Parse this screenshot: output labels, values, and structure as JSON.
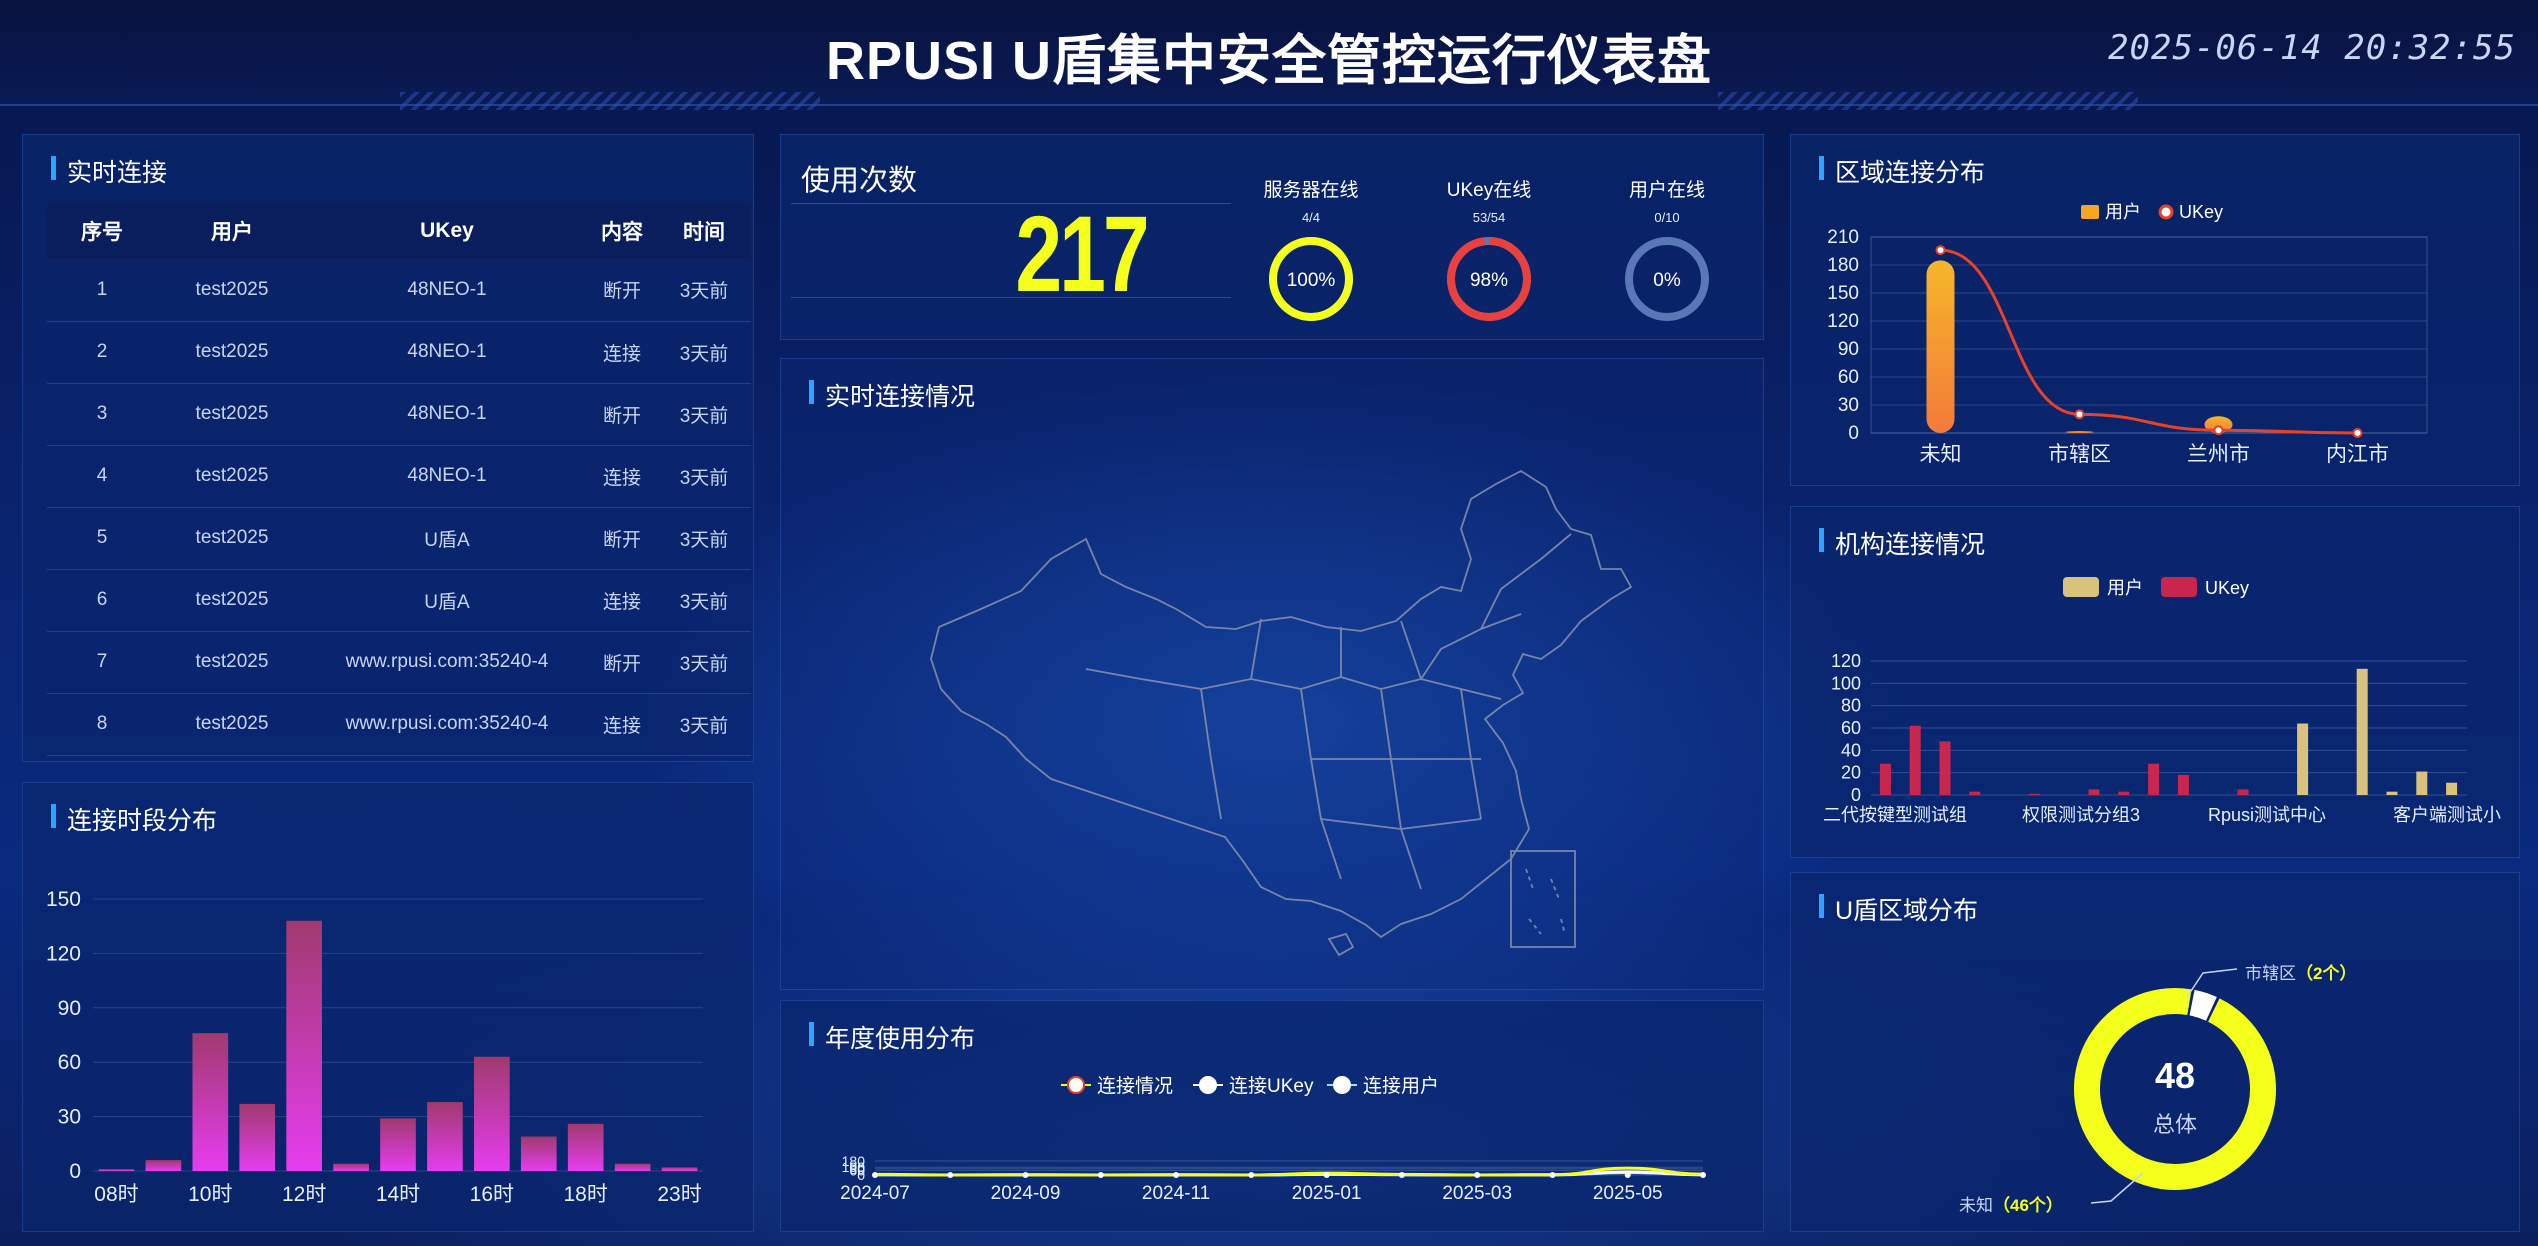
{
  "header": {
    "title": "RPUSI U盾集中安全管控运行仪表盘",
    "datetime": "2025-06-14 20:32:55"
  },
  "realtime_connections": {
    "title": "实时连接",
    "columns": [
      "序号",
      "用户",
      "UKey",
      "内容",
      "时间"
    ],
    "rows": [
      [
        "1",
        "test2025",
        "48NEO-1",
        "断开",
        "3天前"
      ],
      [
        "2",
        "test2025",
        "48NEO-1",
        "连接",
        "3天前"
      ],
      [
        "3",
        "test2025",
        "48NEO-1",
        "断开",
        "3天前"
      ],
      [
        "4",
        "test2025",
        "48NEO-1",
        "连接",
        "3天前"
      ],
      [
        "5",
        "test2025",
        "U盾A",
        "断开",
        "3天前"
      ],
      [
        "6",
        "test2025",
        "U盾A",
        "连接",
        "3天前"
      ],
      [
        "7",
        "test2025",
        "www.rpusi.com:35240-4",
        "断开",
        "3天前"
      ],
      [
        "8",
        "test2025",
        "www.rpusi.com:35240-4",
        "连接",
        "3天前"
      ]
    ]
  },
  "usage": {
    "label": "使用次数",
    "count": "217",
    "rings": [
      {
        "label": "服务器在线",
        "fraction": "4/4",
        "percent": "100%",
        "value": 1.0,
        "color": "#f4ff1a"
      },
      {
        "label": "UKey在线",
        "fraction": "53/54",
        "percent": "98%",
        "value": 0.98,
        "color": "#e8413e"
      },
      {
        "label": "用户在线",
        "fraction": "0/10",
        "percent": "0%",
        "value": 0.0,
        "color": "#5a78b8"
      }
    ]
  },
  "map_panel": {
    "title": "实时连接情况"
  },
  "hour_panel": {
    "title": "连接时段分布"
  },
  "year_panel": {
    "title": "年度使用分布"
  },
  "region_panel": {
    "title": "区域连接分布"
  },
  "org_panel": {
    "title": "机构连接情况"
  },
  "shield_panel": {
    "title": "U盾区域分布",
    "total_value": "48",
    "total_label": "总体",
    "label_a_name": "市辖区",
    "label_a_count": "（2个）",
    "label_b_name": "未知",
    "label_b_count": "（46个）"
  },
  "chart_data": [
    {
      "type": "bar",
      "id": "hour",
      "categories": [
        "08时",
        "09时",
        "10时",
        "11时",
        "12时",
        "13时",
        "14时",
        "15时",
        "16时",
        "17时",
        "18时",
        "19时",
        "23时"
      ],
      "tick_labels": [
        "08时",
        "10时",
        "12时",
        "14时",
        "16时",
        "18时",
        "23时"
      ],
      "values": [
        1,
        6,
        76,
        37,
        138,
        4,
        29,
        38,
        63,
        19,
        26,
        4,
        2
      ],
      "ylim": [
        0,
        150
      ],
      "yticks": [
        "0",
        "30",
        "60",
        "90",
        "120",
        "150"
      ],
      "grid": true
    },
    {
      "type": "line",
      "id": "region",
      "categories": [
        "未知",
        "市辖区",
        "兰州市",
        "内江市"
      ],
      "legend": [
        "用户",
        "UKey"
      ],
      "series": [
        {
          "name": "用户",
          "type": "bar",
          "values": [
            185,
            2,
            18,
            0
          ],
          "color": "#f6a623"
        },
        {
          "name": "UKey",
          "type": "line",
          "values": [
            196,
            20,
            3,
            0
          ],
          "color": "#e8412a"
        }
      ],
      "ylim": [
        0,
        210
      ],
      "yticks": [
        "0",
        "30",
        "60",
        "90",
        "120",
        "150",
        "180",
        "210"
      ],
      "grid": true
    },
    {
      "type": "bar",
      "id": "org",
      "tick_labels": [
        "二代按键型测试组",
        "权限测试分组3",
        "Rpusi测试中心",
        "客户端测试小"
      ],
      "legend": [
        "用户",
        "UKey"
      ],
      "series": [
        {
          "name": "UKey",
          "values": [
            28,
            62,
            48,
            3,
            0,
            1,
            0,
            5,
            3,
            28,
            18,
            0,
            5,
            0,
            0,
            0,
            0,
            0,
            0,
            0
          ],
          "color": "#c8264e"
        },
        {
          "name": "用户",
          "values": [
            0,
            0,
            0,
            0,
            0,
            0,
            0,
            0,
            0,
            0,
            0,
            0,
            0,
            0,
            64,
            0,
            113,
            3,
            21,
            11
          ],
          "color": "#d8c27c"
        }
      ],
      "ylim": [
        0,
        120
      ],
      "yticks": [
        "0",
        "20",
        "40",
        "60",
        "80",
        "100",
        "120"
      ],
      "grid": true
    },
    {
      "type": "line",
      "id": "year",
      "legend": [
        "连接情况",
        "连接UKey",
        "连接用户"
      ],
      "x": [
        "2024-07",
        "2024-08",
        "2024-09",
        "2024-10",
        "2024-11",
        "2024-12",
        "2025-01",
        "2025-02",
        "2025-03",
        "2025-04",
        "2025-05",
        "2025-06"
      ],
      "tick_labels": [
        "2024-07",
        "2024-09",
        "2024-11",
        "2025-01",
        "2025-03",
        "2025-05"
      ],
      "series": [
        {
          "name": "连接情况",
          "values": [
            2,
            0,
            1,
            0,
            1,
            0,
            6,
            2,
            0,
            1,
            22,
            3
          ],
          "color": "#f4ff1a"
        },
        {
          "name": "连接UKey",
          "values": [
            1,
            0,
            1,
            0,
            1,
            0,
            3,
            1,
            0,
            1,
            10,
            1
          ],
          "color": "#ffffff"
        },
        {
          "name": "连接用户",
          "values": [
            1,
            0,
            0,
            0,
            0,
            0,
            2,
            1,
            0,
            0,
            8,
            1
          ],
          "color": "#9fe0ff"
        }
      ],
      "ylim": [
        0,
        180
      ],
      "yticks": [
        "0",
        "60",
        "80",
        "100",
        "180"
      ],
      "grid": true
    },
    {
      "type": "pie",
      "id": "shield",
      "labels": [
        "市辖区",
        "未知"
      ],
      "values": [
        2,
        46
      ],
      "colors": [
        "#ffffff",
        "#f4ff1a"
      ]
    }
  ]
}
